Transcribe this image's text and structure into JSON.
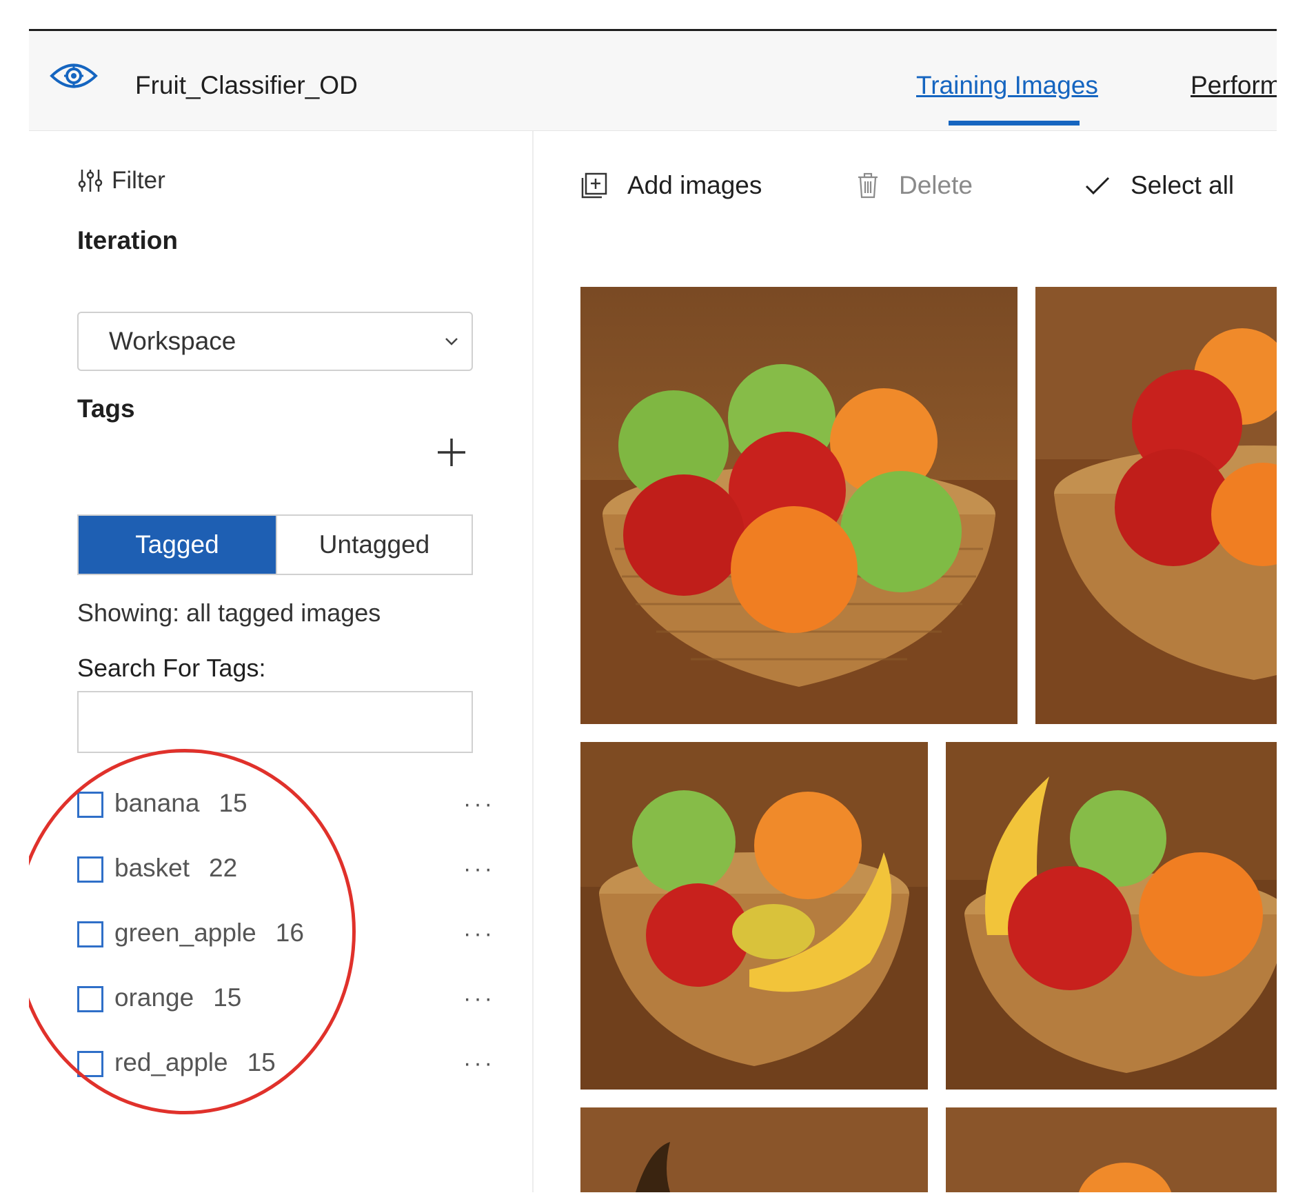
{
  "header": {
    "project_name": "Fruit_Classifier_OD",
    "tabs": [
      {
        "label": "Training Images",
        "active": true
      },
      {
        "label": "Perform"
      }
    ],
    "icon": "eye-icon"
  },
  "sidebar": {
    "filter_label": "Filter",
    "iteration_title": "Iteration",
    "iteration_value": "Workspace",
    "tags_title": "Tags",
    "toggle": {
      "tagged": "Tagged",
      "untagged": "Untagged",
      "selected": "Tagged"
    },
    "showing_text": "Showing: all tagged images",
    "search_label": "Search For Tags:",
    "search_value": "",
    "tags": [
      {
        "name": "banana",
        "count": "15"
      },
      {
        "name": "basket",
        "count": "22"
      },
      {
        "name": "green_apple",
        "count": "16"
      },
      {
        "name": "orange",
        "count": "15"
      },
      {
        "name": "red_apple",
        "count": "15"
      }
    ],
    "more_label": "···"
  },
  "toolbar": {
    "add_images": "Add images",
    "delete": "Delete",
    "select_all": "Select all"
  },
  "colors": {
    "accent": "#1565c0",
    "toggle_active": "#1e5fb3",
    "annotation_circle": "#e0312b"
  }
}
